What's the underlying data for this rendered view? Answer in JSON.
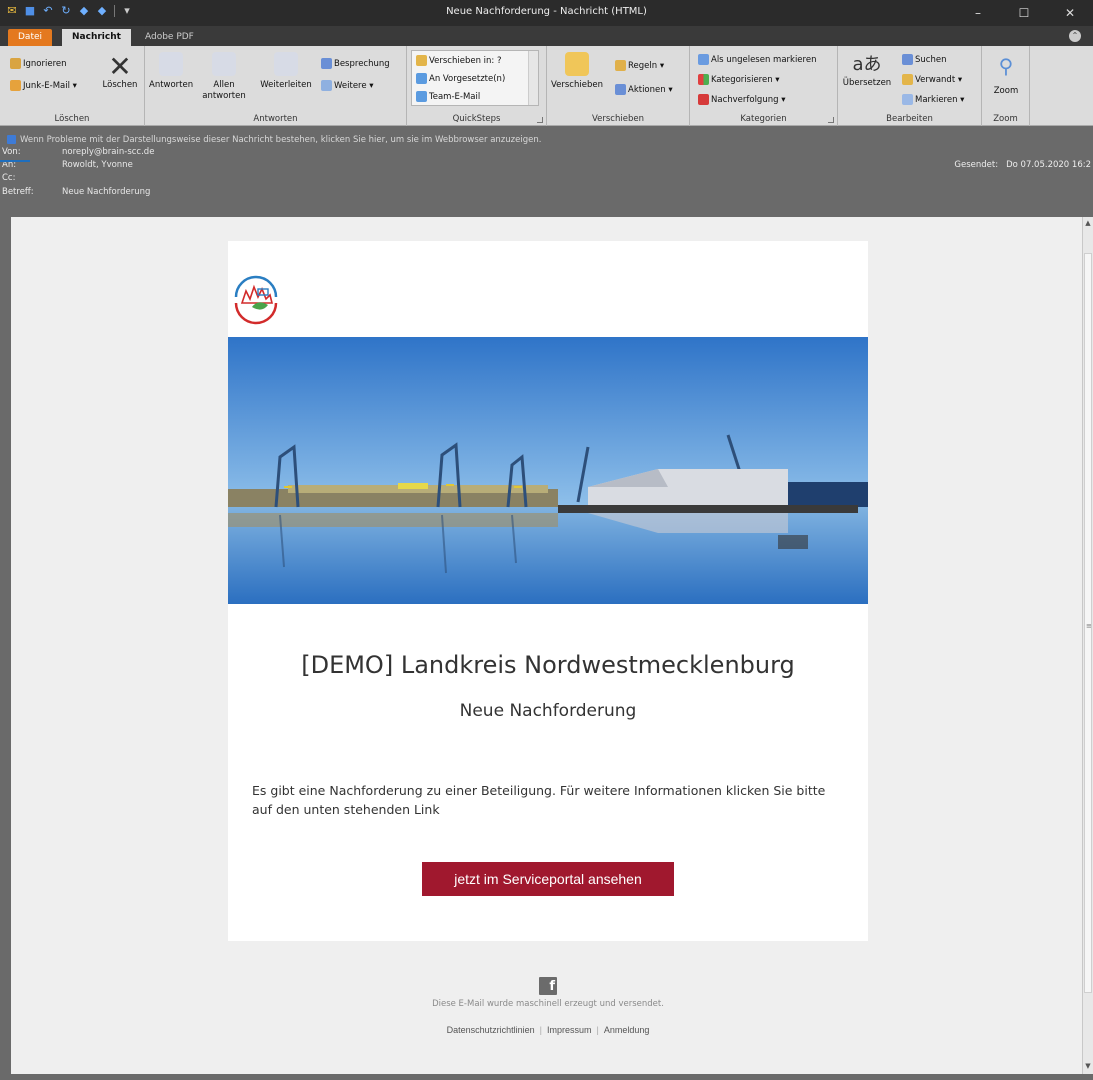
{
  "window": {
    "title": "Neue Nachforderung - Nachricht (HTML)",
    "controls": [
      "–",
      "☐",
      "✕"
    ]
  },
  "tabs": {
    "datei": "Datei",
    "nachricht": "Nachricht",
    "adobe_pdf": "Adobe PDF"
  },
  "ribbon": {
    "loeschen": {
      "label": "Löschen",
      "ignorieren": "Ignorieren",
      "junk": "Junk-E-Mail ▾",
      "loeschen_btn": "Löschen"
    },
    "antworten": {
      "label": "Antworten",
      "antworten": "Antworten",
      "allen_1": "Allen",
      "allen_2": "antworten",
      "weiterleiten": "Weiterleiten",
      "besprechung": "Besprechung",
      "weitere": "Weitere ▾"
    },
    "quicksteps": {
      "label": "QuickSteps",
      "item1": "Verschieben in: ?",
      "item2": "An Vorgesetzte(n)",
      "item3": "Team-E-Mail"
    },
    "verschieben": {
      "label": "Verschieben",
      "verschieben": "Verschieben",
      "regeln": "Regeln ▾",
      "aktionen": "Aktionen ▾"
    },
    "kategorien": {
      "label": "Kategorien",
      "ungelesen": "Als ungelesen markieren",
      "kategorisieren": "Kategorisieren ▾",
      "nachverfolgung": "Nachverfolgung ▾"
    },
    "bearbeiten": {
      "label": "Bearbeiten",
      "uebersetzen": "Übersetzen",
      "suchen": "Suchen",
      "verwandt": "Verwandt ▾",
      "markieren": "Markieren ▾"
    },
    "zoom": {
      "label": "Zoom",
      "zoom": "Zoom"
    }
  },
  "infobar": {
    "notice": "Wenn Probleme mit der Darstellungsweise dieser Nachricht bestehen, klicken Sie hier, um sie im Webbrowser anzuzeigen.",
    "von_label": "Von:",
    "von": "noreply@brain-scc.de",
    "an_label": "An:",
    "an": "Rowoldt, Yvonne",
    "cc_label": "Cc:",
    "cc": "",
    "betreff_label": "Betreff:",
    "betreff": "Neue Nachforderung",
    "gesendet_label": "Gesendet:",
    "gesendet": "Do 07.05.2020 16:2"
  },
  "email": {
    "title": "[DEMO] Landkreis Nordwestmecklenburg",
    "subtitle": "Neue Nachforderung",
    "body": "Es gibt eine Nachforderung zu einer Beteiligung. Für weitere Informationen klicken Sie bitte auf den unten stehenden Link",
    "cta": "jetzt im Serviceportal ansehen",
    "footer_note": "Diese E-Mail wurde maschinell erzeugt und versendet.",
    "facebook_glyph": "f",
    "links": [
      "Datenschutzrichtlinien",
      "Impressum",
      "Anmeldung"
    ]
  },
  "colors": {
    "cta": "#a0182e",
    "datei_tab": "#e4791f",
    "sky": "#3b83d4"
  }
}
